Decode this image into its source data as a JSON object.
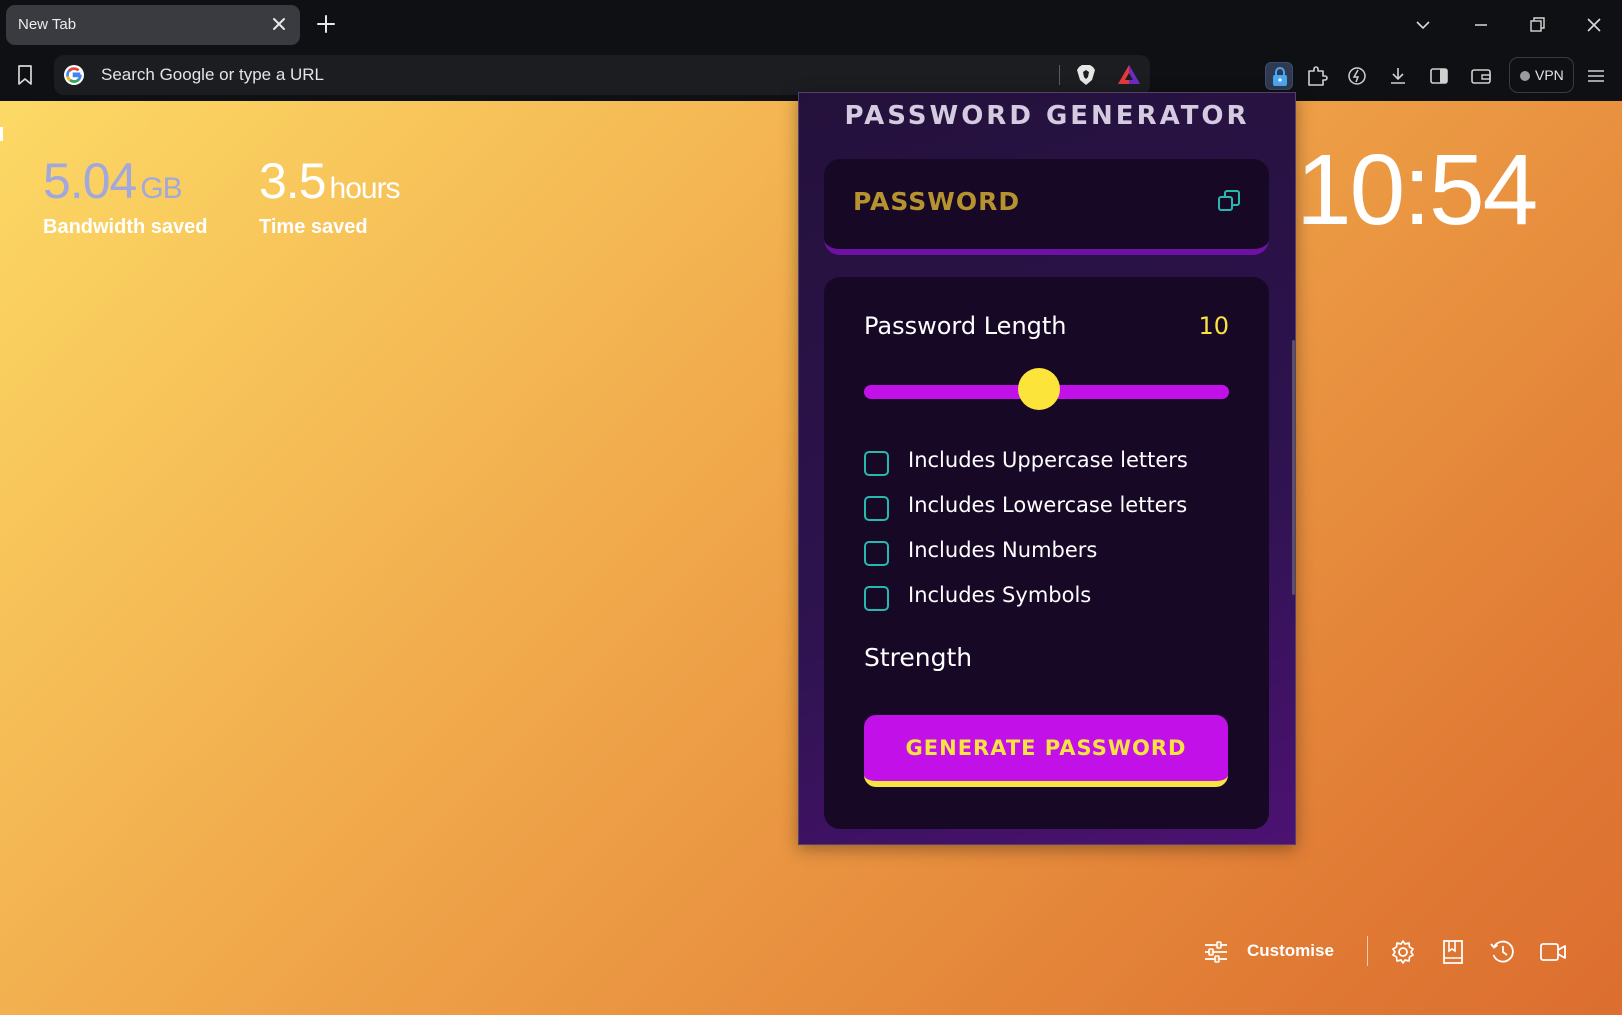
{
  "browser": {
    "tab_title": "New Tab",
    "omnibox_placeholder": "Search Google or type a URL",
    "vpn_label": "VPN"
  },
  "ntp": {
    "stats": [
      {
        "value": "5.04",
        "unit": "GB",
        "label": "Bandwidth saved",
        "color": "#a3a8dc"
      },
      {
        "value": "3.5",
        "unit": "hours",
        "label": "Time saved",
        "color": "#ffffff"
      }
    ],
    "clock": "10:54",
    "customise_label": "Customise"
  },
  "popup": {
    "title": "PASSWORD GENERATOR",
    "password_placeholder": "PASSWORD",
    "length_label": "Password Length",
    "length_value": "10",
    "length_fraction": 0.48,
    "options": [
      {
        "label": "Includes Uppercase letters",
        "checked": false
      },
      {
        "label": "Includes Lowercase letters",
        "checked": false
      },
      {
        "label": "Includes Numbers",
        "checked": false
      },
      {
        "label": "Includes Symbols",
        "checked": false
      }
    ],
    "strength_label": "Strength",
    "generate_label": "GENERATE PASSWORD"
  },
  "colors": {
    "accent_purple": "#c210e8",
    "accent_yellow": "#f8e441",
    "checkbox_teal": "#29b8ad"
  }
}
